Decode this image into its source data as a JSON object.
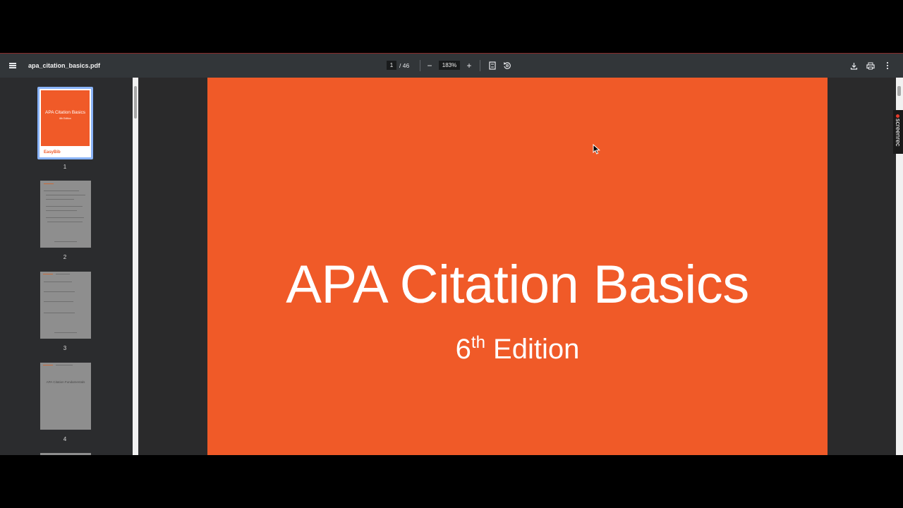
{
  "toolbar": {
    "filename": "apa_citation_basics.pdf",
    "page_current": "1",
    "page_total": "/ 46",
    "zoom": "183%",
    "zoom_out": "−",
    "zoom_in": "+"
  },
  "sidebar": {
    "thumbnails": [
      {
        "number": "1",
        "title": "APA Citation Basics",
        "subtitle": "6th Edition",
        "brand": "EasyBib"
      },
      {
        "number": "2"
      },
      {
        "number": "3"
      },
      {
        "number": "4",
        "title": "APA Citation Fundamentals"
      }
    ]
  },
  "document": {
    "title": "APA Citation Basics",
    "subtitle_number": "6",
    "subtitle_sup": "th",
    "subtitle_text": " Edition"
  },
  "overlay": {
    "recorder_label": "screenrec"
  },
  "colors": {
    "accent": "#f05a28",
    "toolbar": "#323639",
    "selection": "#8ab4f8"
  }
}
